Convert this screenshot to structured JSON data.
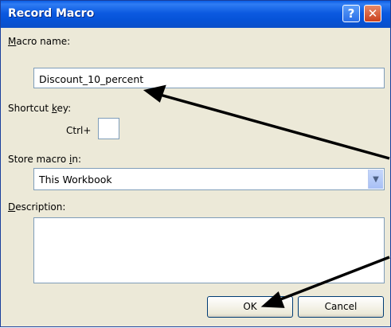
{
  "window": {
    "title": "Record Macro"
  },
  "titlebar": {
    "help_glyph": "?",
    "close_glyph": "✕"
  },
  "macro_name": {
    "label_first": "M",
    "label_rest": "acro name:",
    "value": "Discount_10_percent"
  },
  "shortcut": {
    "label_pre": "Shortcut ",
    "label_u": "k",
    "label_post": "ey:",
    "ctrl_label": "Ctrl+",
    "key_value": ""
  },
  "store": {
    "label_pre": "Store macro ",
    "label_u": "i",
    "label_post": "n:",
    "selected": "This Workbook"
  },
  "description": {
    "label_first": "D",
    "label_rest": "escription:",
    "value": ""
  },
  "buttons": {
    "ok": "OK",
    "cancel": "Cancel"
  },
  "colors": {
    "titlebar": "#0a5ee6",
    "dialog_bg": "#ece9d8",
    "field_border": "#7f9db9"
  }
}
